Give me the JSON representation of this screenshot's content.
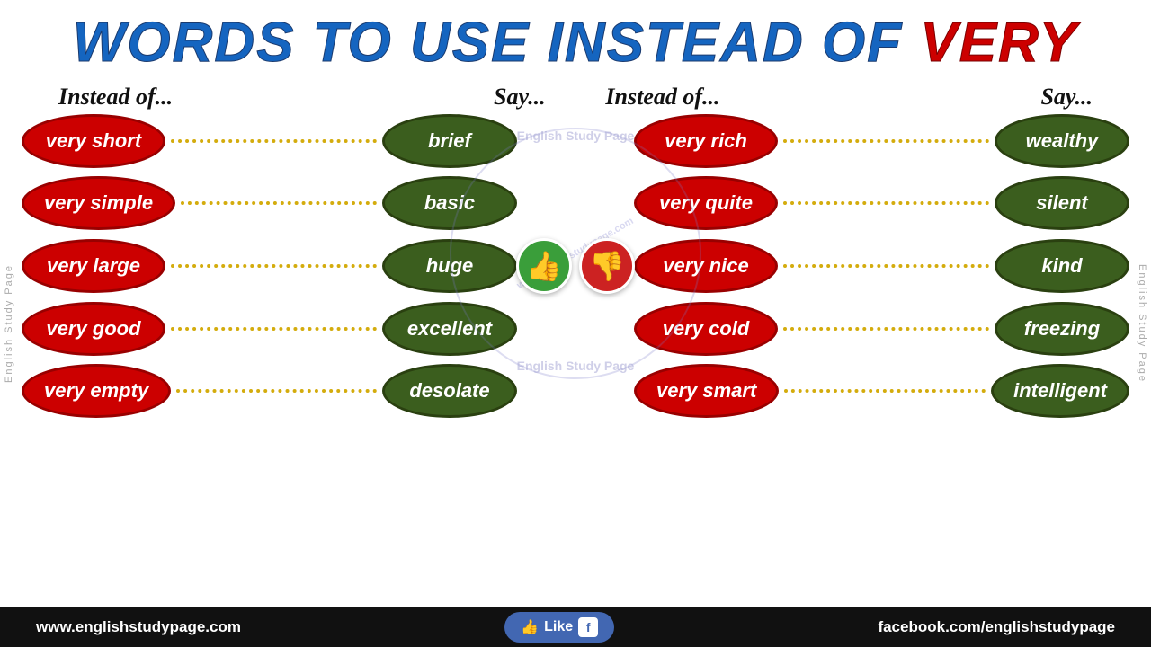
{
  "title": {
    "part1": "WORDS TO USE INSTEAD OF ",
    "part2": "VERY"
  },
  "headers": {
    "instead_of_1": "Instead of...",
    "say_1": "Say...",
    "instead_of_2": "Instead of...",
    "say_2": "Say..."
  },
  "rows": [
    {
      "left_instead": "very short",
      "left_say": "brief",
      "right_instead": "very rich",
      "right_say": "wealthy"
    },
    {
      "left_instead": "very simple",
      "left_say": "basic",
      "right_instead": "very quite",
      "right_say": "silent"
    },
    {
      "left_instead": "very large",
      "left_say": "huge",
      "right_instead": "very nice",
      "right_say": "kind"
    },
    {
      "left_instead": "very good",
      "left_say": "excellent",
      "right_instead": "very cold",
      "right_say": "freezing"
    },
    {
      "left_instead": "very empty",
      "left_say": "desolate",
      "right_instead": "very smart",
      "right_say": "intelligent"
    }
  ],
  "watermarks": {
    "center_top": "English Study Page",
    "center_url": "www.englishstudypage.com",
    "center_bottom": "English Study Page"
  },
  "side_labels": {
    "left": "English Study Page",
    "right": "English Study Page"
  },
  "footer": {
    "website": "www.englishstudypage.com",
    "like_text": "Like",
    "facebook": "facebook.com/englishstudypage"
  },
  "thumbs": {
    "up": "👍",
    "down": "👎"
  }
}
